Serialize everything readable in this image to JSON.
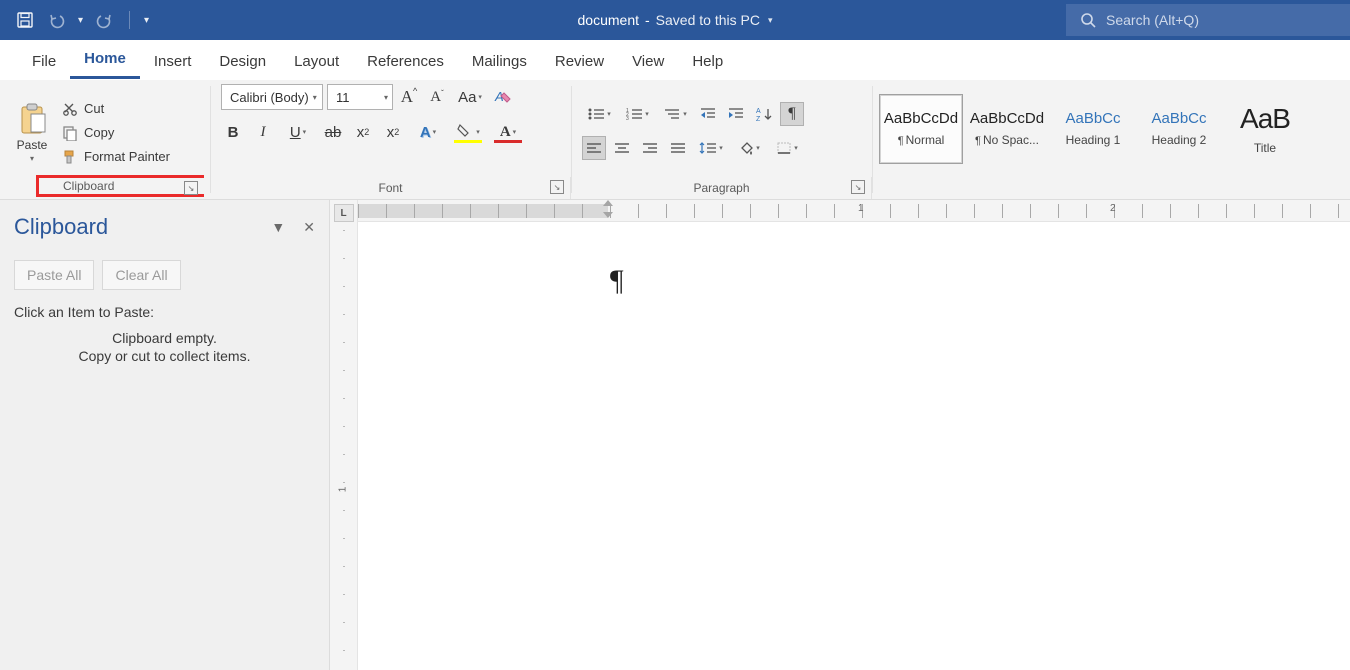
{
  "titlebar": {
    "doc_name": "document",
    "saved_status": "Saved to this PC",
    "search_placeholder": "Search (Alt+Q)"
  },
  "tabs": {
    "file": "File",
    "home": "Home",
    "insert": "Insert",
    "design": "Design",
    "layout": "Layout",
    "references": "References",
    "mailings": "Mailings",
    "review": "Review",
    "view": "View",
    "help": "Help"
  },
  "ribbon": {
    "clipboard": {
      "paste": "Paste",
      "cut": "Cut",
      "copy": "Copy",
      "format_painter": "Format Painter",
      "group_label": "Clipboard"
    },
    "font": {
      "name": "Calibri (Body)",
      "size": "11",
      "group_label": "Font"
    },
    "paragraph": {
      "group_label": "Paragraph"
    },
    "styles": {
      "sample": "AaBbCcDd",
      "sample_short": "AaBbCc",
      "sample_title": "AaB",
      "normal": "Normal",
      "no_spacing": "No Spac...",
      "heading1": "Heading 1",
      "heading2": "Heading 2",
      "title": "Title"
    }
  },
  "pane": {
    "title": "Clipboard",
    "paste_all": "Paste All",
    "clear_all": "Clear All",
    "prompt": "Click an Item to Paste:",
    "empty1": "Clipboard empty.",
    "empty2": "Copy or cut to collect items."
  },
  "ruler": {
    "h1": "1",
    "h2": "2",
    "v1": "1"
  }
}
